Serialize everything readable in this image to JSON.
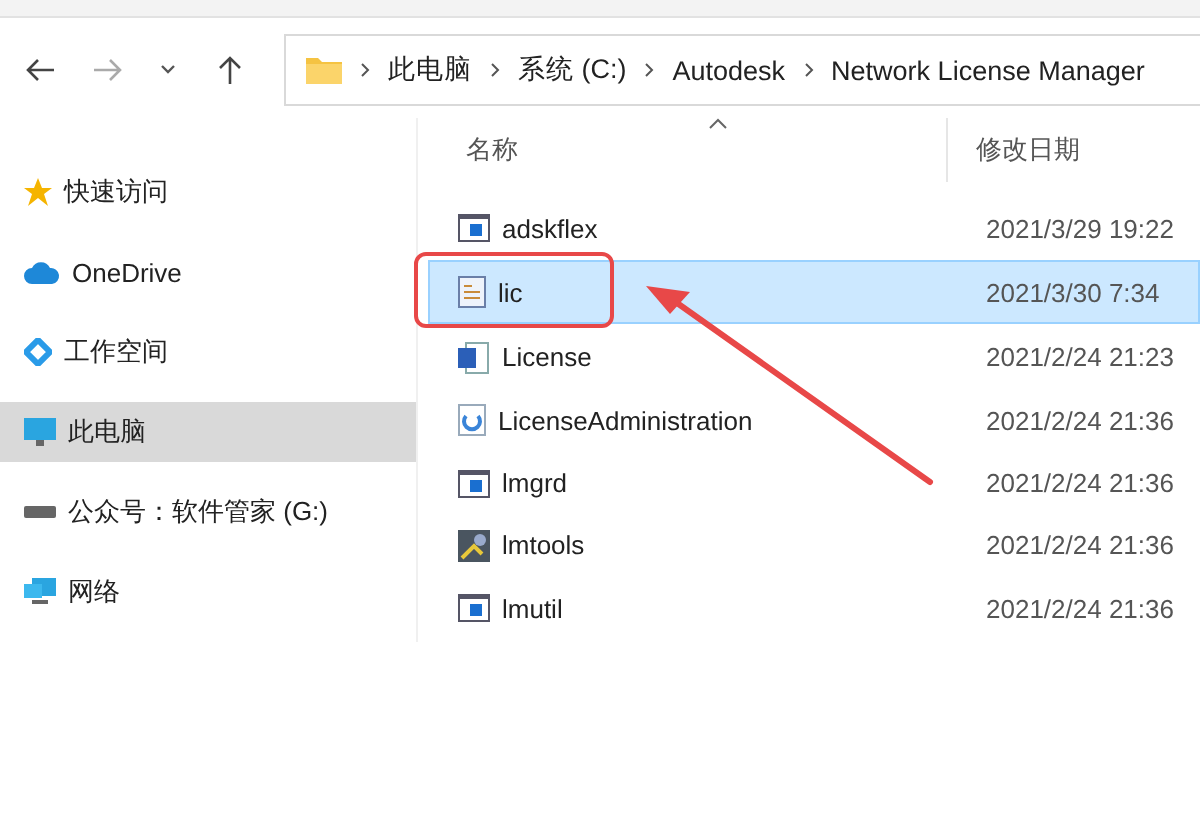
{
  "address_bar": {
    "path": [
      "此电脑",
      "系统 (C:)",
      "Autodesk",
      "Network License Manager"
    ]
  },
  "sidebar": {
    "items": [
      {
        "label": "快速访问",
        "kind": "star",
        "selected": false
      },
      {
        "label": "OneDrive",
        "kind": "cloud",
        "selected": false
      },
      {
        "label": "工作空间",
        "kind": "diamond",
        "selected": false
      },
      {
        "label": "此电脑",
        "kind": "pc",
        "selected": true
      },
      {
        "label": "公众号：软件管家 (G:)",
        "kind": "drive",
        "selected": false
      },
      {
        "label": "网络",
        "kind": "network",
        "selected": false
      }
    ]
  },
  "file_list": {
    "columns": [
      "名称",
      "修改日期"
    ],
    "rows": [
      {
        "name": "adskflex",
        "modified": "2021/3/29 19:22",
        "kind": "exe",
        "selected": false
      },
      {
        "name": "lic",
        "modified": "2021/3/30 7:34",
        "kind": "lic",
        "selected": true
      },
      {
        "name": "License",
        "modified": "2021/2/24 21:23",
        "kind": "doc",
        "selected": false
      },
      {
        "name": "LicenseAdministration",
        "modified": "2021/2/24 21:36",
        "kind": "app",
        "selected": false
      },
      {
        "name": "lmgrd",
        "modified": "2021/2/24 21:36",
        "kind": "exe",
        "selected": false
      },
      {
        "name": "lmtools",
        "modified": "2021/2/24 21:36",
        "kind": "tool",
        "selected": false
      },
      {
        "name": "lmutil",
        "modified": "2021/2/24 21:36",
        "kind": "exe",
        "selected": false
      }
    ]
  }
}
